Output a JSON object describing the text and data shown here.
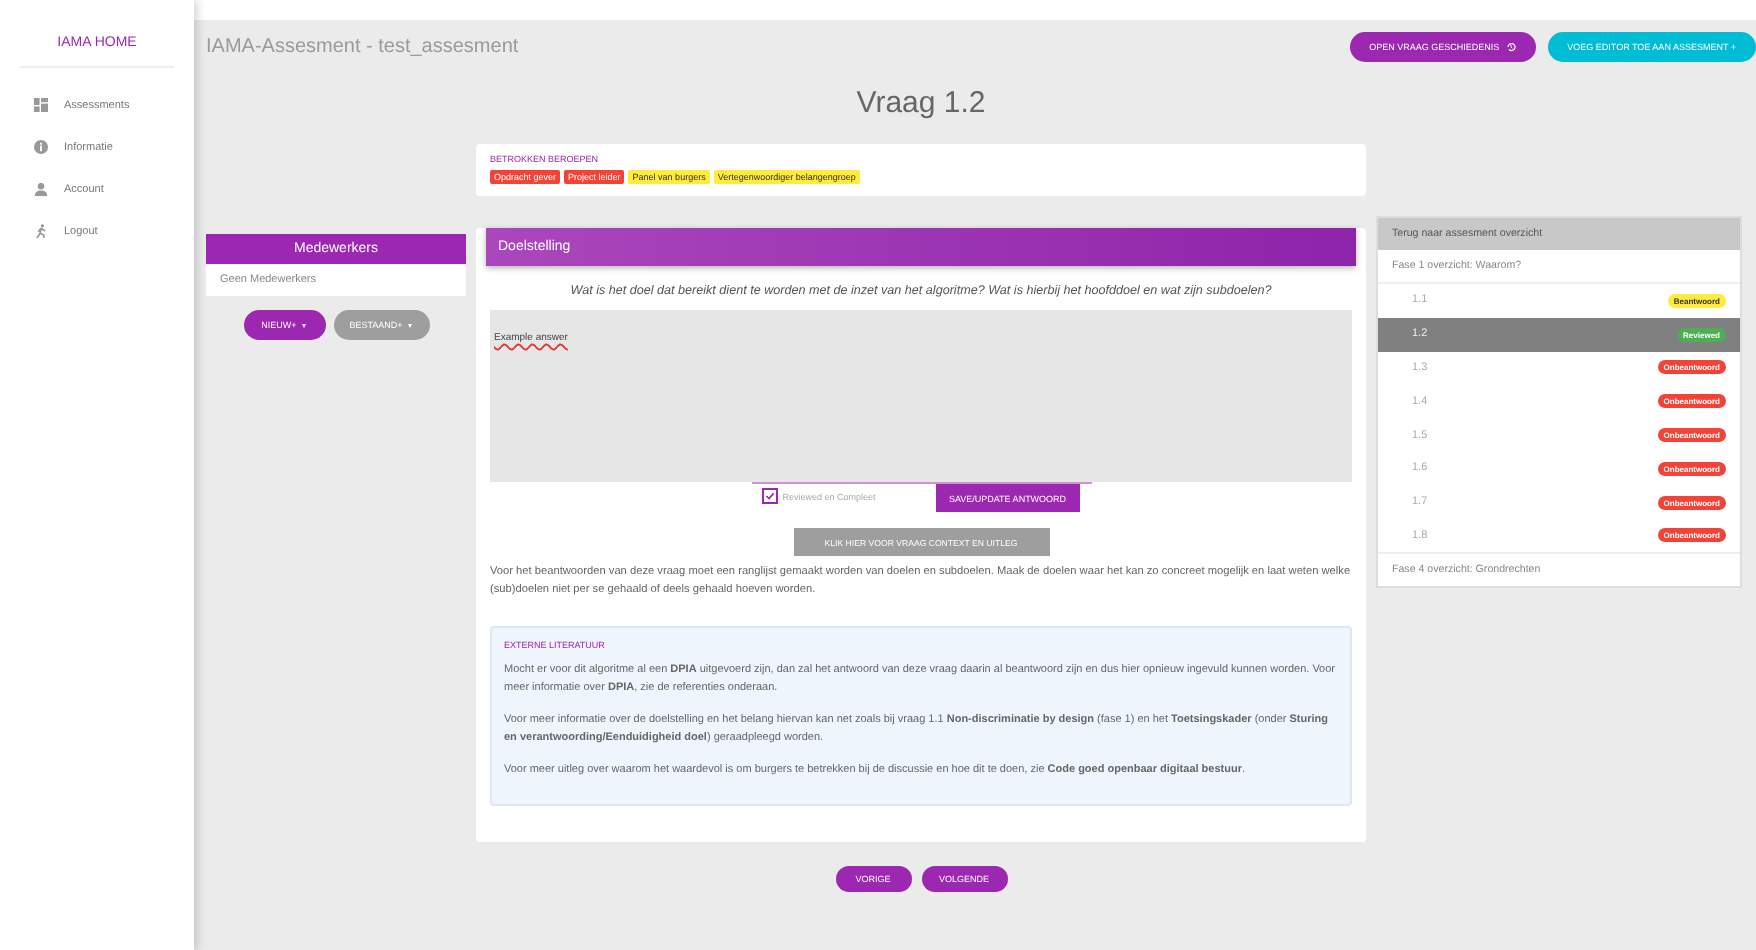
{
  "sidebar": {
    "title": "IAMA HOME",
    "items": [
      {
        "label": "Assessments",
        "kind": "grid"
      },
      {
        "label": "Informatie",
        "kind": "info"
      },
      {
        "label": "Account",
        "kind": "person"
      },
      {
        "label": "Logout",
        "kind": "run"
      }
    ]
  },
  "header": {
    "title": "IAMA-Assesment - test_assesment",
    "buttons": [
      {
        "label": "OPEN VRAAG GESCHIEDENIS",
        "kind": "history"
      },
      {
        "label": "VOEG EDITOR TOE AAN ASSESMENT +",
        "kind": "add"
      }
    ]
  },
  "question_title": "Vraag 1.2",
  "stakeholders": {
    "heading": "BETROKKEN BEROEPEN",
    "tags": [
      {
        "label": "Opdracht gever",
        "color": "#f44336"
      },
      {
        "label": "Project leider",
        "color": "#f44336"
      },
      {
        "label": "Panel van burgers",
        "color": "#ffeb3b"
      },
      {
        "label": "Vertegenwoordiger belangengroep",
        "color": "#ffeb3b"
      }
    ]
  },
  "collaborators": {
    "title": "Medewerkers",
    "empty_text": "Geen Medewerkers",
    "buttons": [
      {
        "label": "NIEUW+",
        "kind": "primary"
      },
      {
        "label": "BESTAAND+",
        "kind": "secondary"
      }
    ]
  },
  "question": {
    "section": "Doelstelling",
    "text": "Wat is het doel dat bereikt dient te worden met de inzet van het algoritme? Wat is hierbij het hoofddoel en wat zijn subdoelen?",
    "answer": "Example answer",
    "checkbox": {
      "label": "Reviewed en Compleet",
      "checked": true
    },
    "save_button": "SAVE/UPDATE ANTWOORD",
    "context_button": "KLIK HIER VOOR VRAAG CONTEXT EN UITLEG",
    "context_text": "Voor het beantwoorden van deze vraag moet een ranglijst gemaakt worden van doelen en subdoelen. Maak de doelen waar het kan zo concreet mogelijk en laat weten welke (sub)doelen niet per se gehaald of deels gehaald hoeven worden.",
    "literature": {
      "heading": "EXTERNE LITERATUUR",
      "paragraphs": [
        "Mocht er voor dit algoritme al een **DPIA** uitgevoerd zijn, dan zal het antwoord van deze vraag daarin al beantwoord zijn en dus hier opnieuw ingevuld kunnen worden. Voor meer informatie over **DPIA**, zie de referenties onderaan.",
        "Voor meer informatie over de doelstelling en het belang hiervan kan net zoals bij vraag 1.1 **Non-discriminatie by design** (fase 1) en het **Toetsingskader** (onder **Sturing en verantwoording/Eenduidigheid doel**) geraadpleegd worden.",
        "Voor meer uitleg over waarom het waardevol is om burgers te betrekken bij de discussie en hoe dit te doen, zie **Code goed openbaar digitaal bestuur**."
      ]
    }
  },
  "navigation": {
    "buttons": [
      "VORIGE",
      "VOLGENDE"
    ]
  },
  "overview": {
    "back": "Terug naar assesment overzicht",
    "phase": "Fase 1 overzicht: Waarom?",
    "items": [
      {
        "label": "1.1",
        "status": "Beantwoord",
        "color": "#ffeb3b",
        "selected": false
      },
      {
        "label": "1.2",
        "status": "Reviewed",
        "color": "#4caf50",
        "selected": true
      },
      {
        "label": "1.3",
        "status": "Onbeantwoord",
        "color": "#f44336",
        "selected": false
      },
      {
        "label": "1.4",
        "status": "Onbeantwoord",
        "color": "#f44336",
        "selected": false
      },
      {
        "label": "1.5",
        "status": "Onbeantwoord",
        "color": "#f44336",
        "selected": false
      },
      {
        "label": "1.6",
        "status": "Onbeantwoord",
        "color": "#f44336",
        "selected": false
      },
      {
        "label": "1.7",
        "status": "Onbeantwoord",
        "color": "#f44336",
        "selected": false
      },
      {
        "label": "1.8",
        "status": "Onbeantwoord",
        "color": "#f44336",
        "selected": false
      }
    ],
    "next_phase": "Fase 4 overzicht: Grondrechten"
  }
}
